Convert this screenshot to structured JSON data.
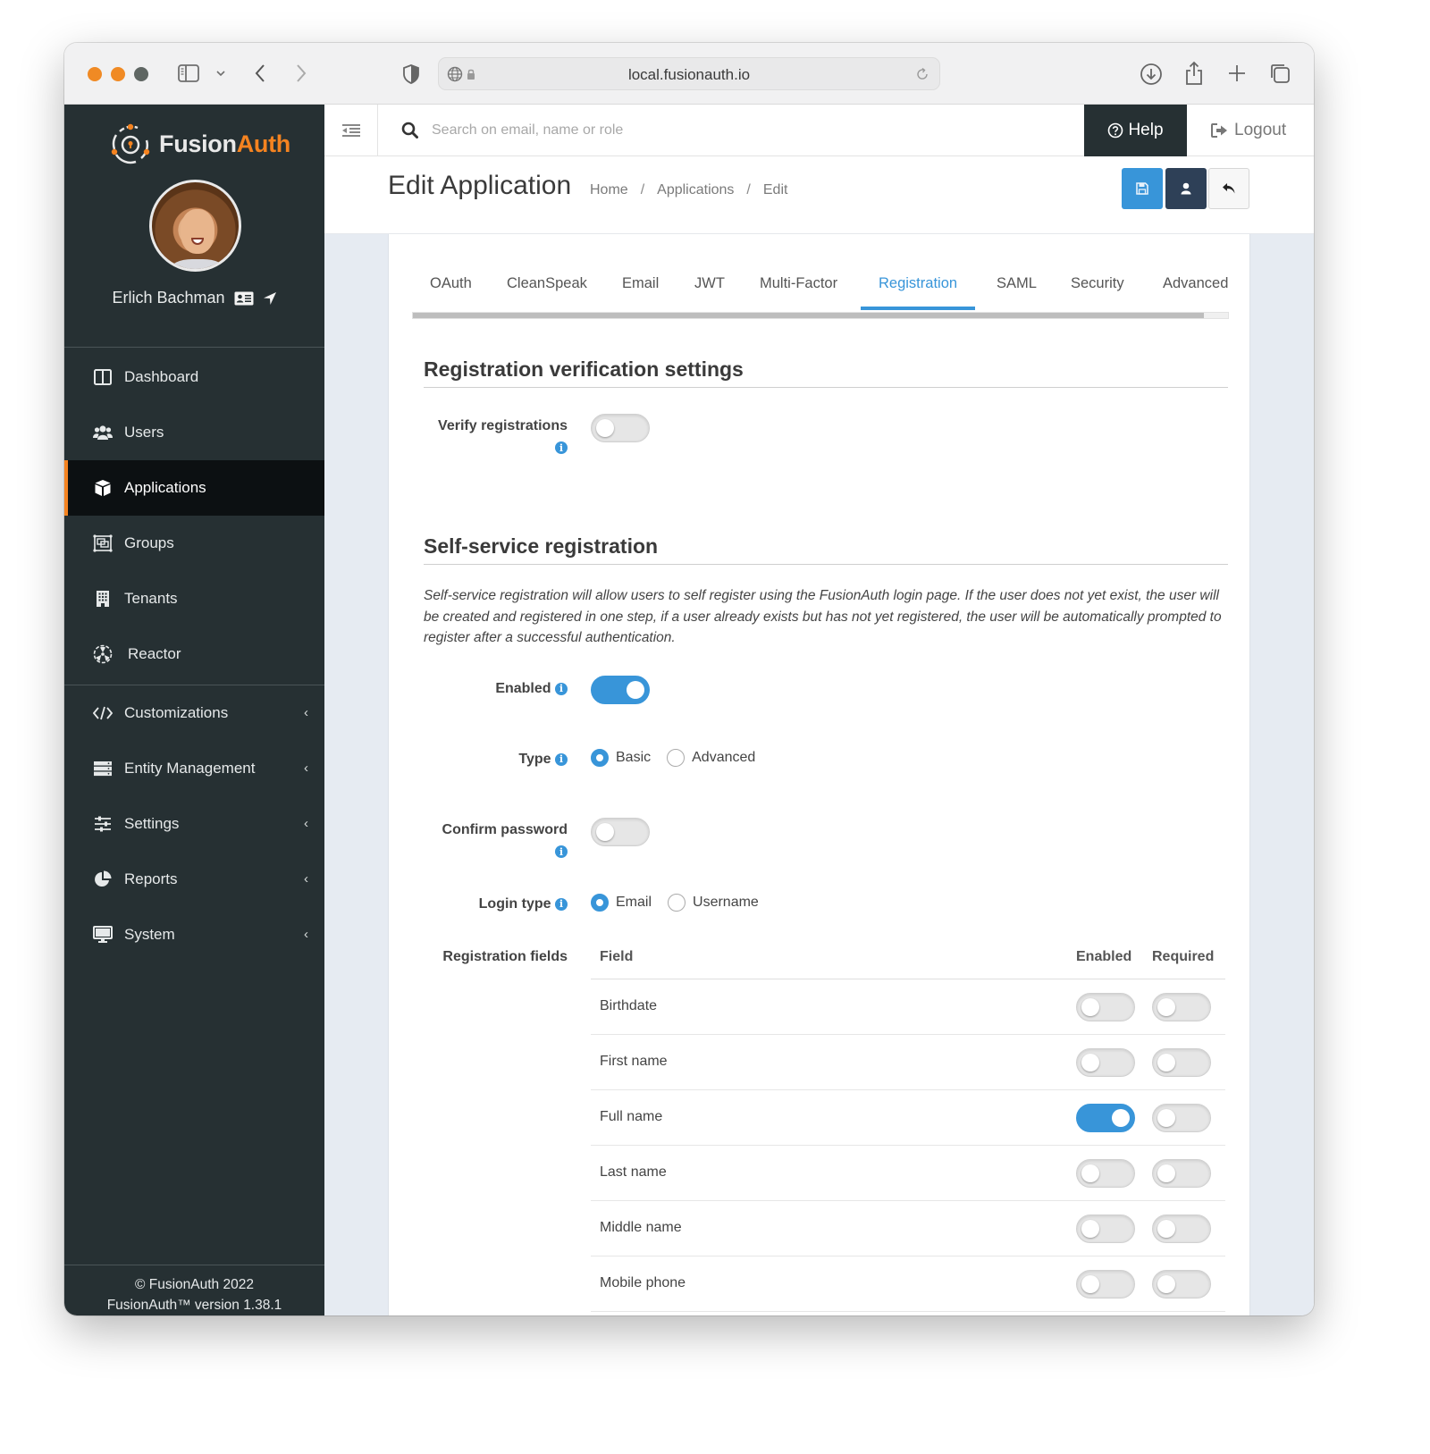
{
  "browser": {
    "url": "local.fusionauth.io",
    "traffic_lights": [
      "#f08a24",
      "#f08a24",
      "#5f6663"
    ]
  },
  "brand": {
    "name_part1": "Fusion",
    "name_part2": "Auth",
    "accent": "#f58320",
    "primary": "#3895d9",
    "sidebar_bg": "#263033"
  },
  "user": {
    "name": "Erlich Bachman"
  },
  "sidebar": {
    "items": [
      {
        "label": "Dashboard",
        "icon": "dashboard-icon",
        "active": false
      },
      {
        "label": "Users",
        "icon": "users-icon",
        "active": false
      },
      {
        "label": "Applications",
        "icon": "cube-icon",
        "active": true
      },
      {
        "label": "Groups",
        "icon": "groups-icon",
        "active": false
      },
      {
        "label": "Tenants",
        "icon": "building-icon",
        "active": false
      },
      {
        "label": "Reactor",
        "icon": "reactor-icon",
        "active": false
      }
    ],
    "expandable_items": [
      {
        "label": "Customizations",
        "icon": "code-icon"
      },
      {
        "label": "Entity Management",
        "icon": "server-icon"
      },
      {
        "label": "Settings",
        "icon": "sliders-icon"
      },
      {
        "label": "Reports",
        "icon": "pie-chart-icon"
      },
      {
        "label": "System",
        "icon": "monitor-icon"
      }
    ],
    "footer": {
      "copyright": "© FusionAuth 2022",
      "version": "FusionAuth™ version 1.38.1"
    }
  },
  "topbar": {
    "search_placeholder": "Search on email, name or role",
    "help_label": "Help",
    "logout_label": "Logout"
  },
  "header": {
    "title": "Edit Application",
    "breadcrumb": [
      "Home",
      "Applications",
      "Edit"
    ]
  },
  "tabs": [
    {
      "label": "OAuth",
      "active": false
    },
    {
      "label": "CleanSpeak",
      "active": false
    },
    {
      "label": "Email",
      "active": false
    },
    {
      "label": "JWT",
      "active": false
    },
    {
      "label": "Multi-Factor",
      "active": false
    },
    {
      "label": "Registration",
      "active": true
    },
    {
      "label": "SAML",
      "active": false
    },
    {
      "label": "Security",
      "active": false
    },
    {
      "label": "Advanced",
      "active": false
    }
  ],
  "tab_scroll_position": 0.97,
  "verification": {
    "title": "Registration verification settings",
    "verify_label": "Verify registrations",
    "verify_enabled": false
  },
  "self_service": {
    "title": "Self-service registration",
    "description": "Self-service registration will allow users to self register using the FusionAuth login page. If the user does not yet exist, the user will be created and registered in one step, if a user already exists but has not yet registered, the user will be automatically prompted to register after a successful authentication.",
    "enabled_label": "Enabled",
    "enabled": true,
    "type_label": "Type",
    "type_options": [
      "Basic",
      "Advanced"
    ],
    "type_selected": "Basic",
    "confirm_password_label": "Confirm password",
    "confirm_password": false,
    "login_type_label": "Login type",
    "login_type_options": [
      "Email",
      "Username"
    ],
    "login_type_selected": "Email",
    "fields_label": "Registration fields",
    "fields_columns": [
      "Field",
      "Enabled",
      "Required"
    ],
    "fields": [
      {
        "name": "Birthdate",
        "enabled": false,
        "required": false
      },
      {
        "name": "First name",
        "enabled": false,
        "required": false
      },
      {
        "name": "Full name",
        "enabled": true,
        "required": false
      },
      {
        "name": "Last name",
        "enabled": false,
        "required": false
      },
      {
        "name": "Middle name",
        "enabled": false,
        "required": false
      },
      {
        "name": "Mobile phone",
        "enabled": false,
        "required": false
      }
    ]
  }
}
